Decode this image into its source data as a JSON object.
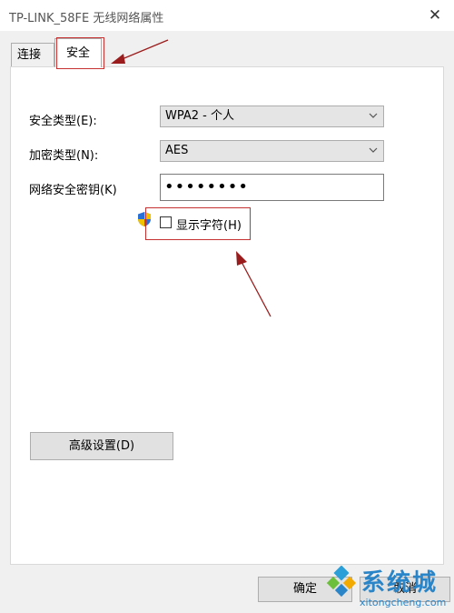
{
  "window": {
    "title": "TP-LINK_58FE 无线网络属性",
    "close_glyph": "✕"
  },
  "tabs": [
    {
      "label": "连接",
      "active": false
    },
    {
      "label": "安全",
      "active": true
    }
  ],
  "security": {
    "type_label": "安全类型(E):",
    "type_value": "WPA2 - 个人",
    "encryption_label": "加密类型(N):",
    "encryption_value": "AES",
    "key_label": "网络安全密钥(K)",
    "key_value": "••••••••",
    "show_chars_label": "显示字符(H)",
    "show_chars_checked": false
  },
  "buttons": {
    "advanced": "高级设置(D)",
    "ok": "确定",
    "cancel": "取消"
  },
  "watermark": {
    "big_text": "系统城",
    "small_text": "xitongcheng.com"
  },
  "colors": {
    "annotation_red": "#c53030",
    "shield_blue": "#2a6fd6",
    "shield_yellow": "#f2c200",
    "watermark_blue": "#2a85c8"
  }
}
